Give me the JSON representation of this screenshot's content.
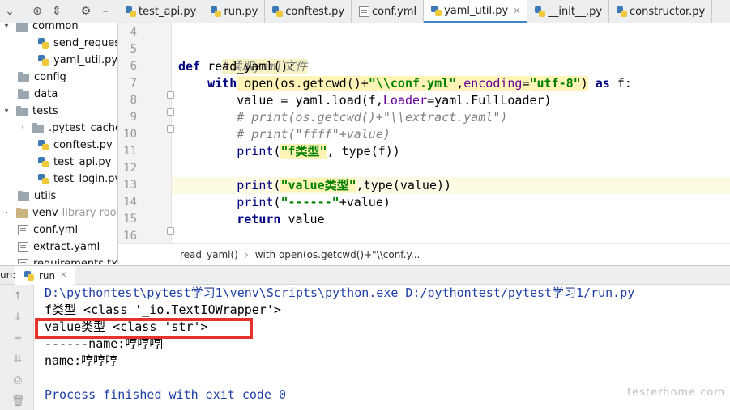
{
  "tabs": [
    {
      "label": "test_api.py",
      "icon": "python-file-icon"
    },
    {
      "label": "run.py",
      "icon": "python-file-icon"
    },
    {
      "label": "conftest.py",
      "icon": "python-file-icon"
    },
    {
      "label": "conf.yml",
      "icon": "yaml-file-icon"
    },
    {
      "label": "yaml_util.py",
      "icon": "python-file-icon",
      "active": true
    },
    {
      "label": "__init__.py",
      "icon": "python-file-icon"
    },
    {
      "label": "constructor.py",
      "icon": "python-file-icon"
    }
  ],
  "tree": {
    "common": "common",
    "send_request": "send_request.py",
    "yaml_util": "yaml_util.py",
    "config": "config",
    "data": "data",
    "tests": "tests",
    "pytest_cache": ".pytest_cache",
    "conftest": "conftest.py",
    "test_api": "test_api.py",
    "test_login": "test_login.py",
    "utils": "utils",
    "venv": "venv",
    "venv_note": "library root",
    "conf_yml": "conf.yml",
    "extract_yaml": "extract.yaml",
    "requirements": "requirements.txt"
  },
  "editor": {
    "line_numbers": [
      "4",
      "5",
      "6",
      "7",
      "8",
      "9",
      "10",
      "11",
      "12",
      "13",
      "14",
      "15",
      "16"
    ],
    "comment_read": "#读取yaml文件",
    "kw_def": "def",
    "fn_sig": " read_yaml():",
    "kw_with": "with",
    "open_call": " open(os.getcwd()+",
    "str_path": "\"\\\\conf.yml\"",
    "comma": ",",
    "param_encoding": "encoding",
    "eq": "=",
    "str_utf8": "\"utf-8\"",
    "close_paren": ")",
    "kw_as": "as",
    "as_target": " f:",
    "load_a": "value = yaml.load(f,",
    "param_loader": "Loader",
    "load_b": "=yaml.FullLoader)",
    "comment_1": "# print(os.getcwd()+\"\\\\extract.yaml\")",
    "comment_2": "# print(\"ffff\"+value)",
    "kw_print": "print",
    "open_p": "(",
    "str_ftype": "\"f类型\"",
    "type_call": ", type(f))",
    "str_valuetype": "\"value类型\"",
    "type_value": ",type(value))",
    "str_dash": "\"------\"",
    "plus_value": "+value)",
    "kw_return": "return",
    "return_val": " value"
  },
  "breadcrumb": [
    "read_yaml()",
    "with open(os.getcwd()+\"\\\\conf.y..."
  ],
  "run": {
    "label": "un:",
    "tab": "run",
    "console": [
      "D:\\pythontest\\pytest学习1\\venv\\Scripts\\python.exe D:/pythontest/pytest学习1/run.py",
      "f类型 <class '_io.TextIOWrapper'>",
      "value类型 <class 'str'>",
      "------name:哼哼哼",
      "name:哼哼哼",
      "",
      "Process finished with exit code 0"
    ]
  },
  "watermark": "testerhome.com"
}
